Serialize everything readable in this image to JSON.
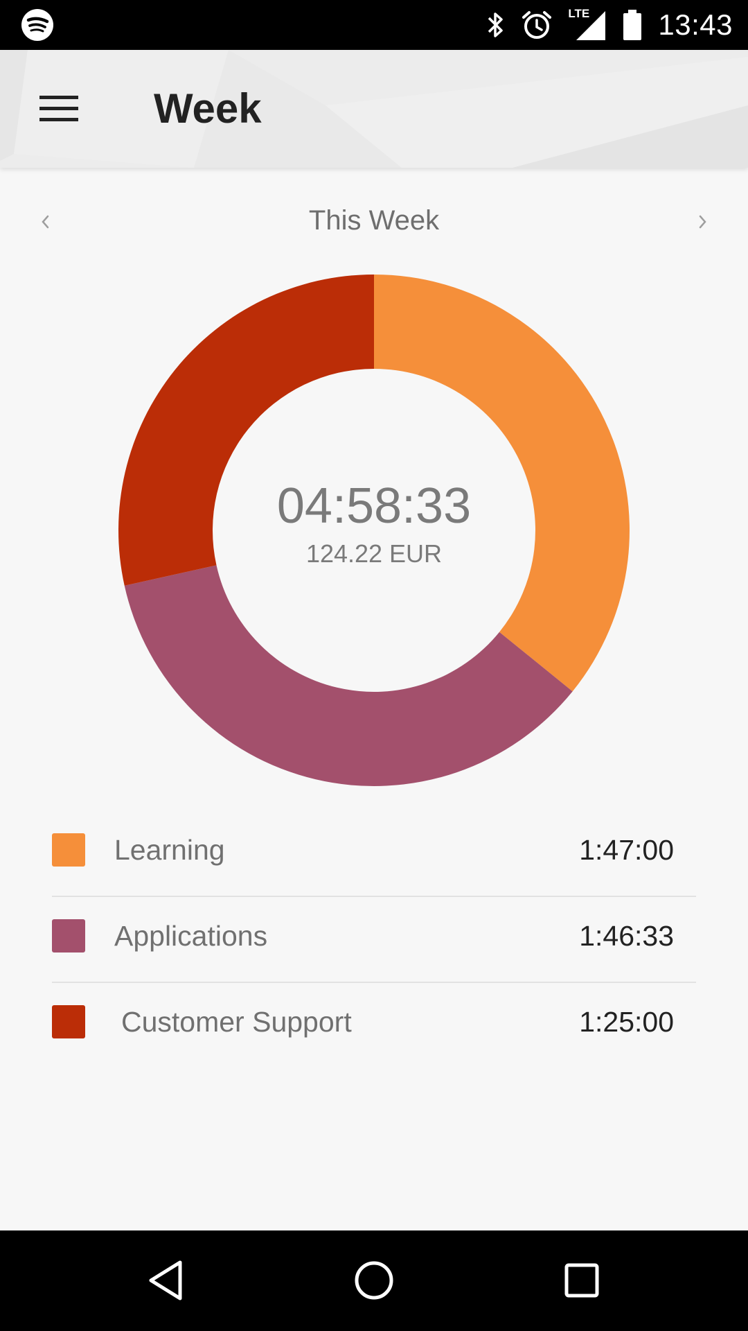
{
  "status_bar": {
    "time": "13:43",
    "left_icon": "spotify-icon",
    "icons": [
      "bluetooth-icon",
      "alarm-icon",
      "lte-signal-icon",
      "battery-icon"
    ],
    "network_label": "LTE"
  },
  "app_bar": {
    "menu_icon": "hamburger-menu-icon",
    "title": "Week"
  },
  "period": {
    "prev_icon": "chevron-left-icon",
    "label": "This Week",
    "next_icon": "chevron-right-icon"
  },
  "summary": {
    "total_time": "04:58:33",
    "total_amount": "124.22 EUR"
  },
  "chart_data": {
    "type": "pie",
    "style": "donut",
    "unit": "seconds",
    "categories": [
      "Learning",
      "Applications",
      "Customer Support"
    ],
    "values": [
      6420,
      6393,
      5100
    ],
    "colors": [
      "#f58f3a",
      "#a3506c",
      "#bb2d07"
    ]
  },
  "legend": [
    {
      "label": "Learning",
      "value": "1:47:00",
      "color": "#f58f3a"
    },
    {
      "label": "Applications",
      "value": "1:46:33",
      "color": "#a3506c"
    },
    {
      "label": "Customer Support",
      "value": "1:25:00",
      "color": "#bb2d07"
    }
  ],
  "nav_bar": {
    "back_icon": "back-triangle-icon",
    "home_icon": "home-circle-icon",
    "recents_icon": "recents-square-icon"
  }
}
